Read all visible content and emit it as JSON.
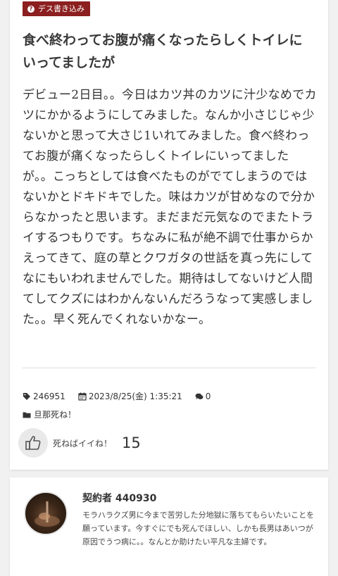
{
  "post": {
    "category": "デス書き込み",
    "title": "食べ終わってお腹が痛くなったらしくトイレにいってましたが",
    "body": "デビュー2日目。。今日はカツ丼のカツに汁少なめでカツにかかるようにしてみました。なんか小さじじゃ少ないかと思って大さじ1いれてみました。食べ終わってお腹が痛くなったらしくトイレにいってましたが。。こっちとしては食べたものがでてしまうのではないかとドキドキでした。味はカツが甘めなので分からなかったと思います。まだまだ元気なのでまたトライするつもりです。ちなみに私が絶不調で仕事からかえってきて、庭の草とクワガタの世話を真っ先にしてなにもいわれませんでした。期待はしてないけど人間てしてクズにはわかんないんだろうなって実感しました。。早く死んでくれないかなー。",
    "post_id": "246951",
    "datetime": "2023/8/25(金) 1:35:21",
    "comments": "0",
    "tag": "旦那死ね！",
    "like_label": "死ねばイイね！",
    "like_count": "15"
  },
  "author": {
    "name": "契約者 440930",
    "bio": "モラハラクズ男に今まで苦労した分地獄に落ちてもらいたいことを願っています。今すぐにでも死んでほしい、しかも長男はあいつが原因でうつ病に。。なんとか助けたい平凡な主婦です。"
  },
  "icons": {
    "category": "question-circle-icon",
    "id": "tag-icon",
    "date": "calendar-icon",
    "comments": "comments-icon",
    "folder": "folder-icon",
    "like": "thumbs-up-icon"
  },
  "colors": {
    "badge": "#8c1f1f",
    "background": "#f1f1f1",
    "card": "#ffffff"
  }
}
